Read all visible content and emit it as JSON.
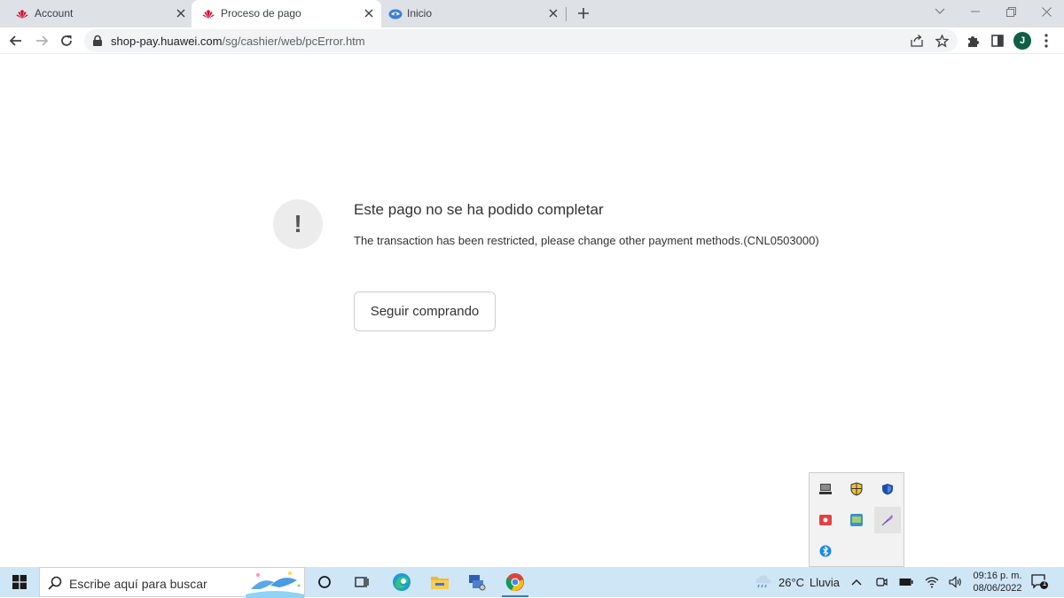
{
  "tabs": [
    {
      "title": "Account",
      "favicon": "huawei-icon",
      "active": false
    },
    {
      "title": "Proceso de pago",
      "favicon": "huawei-icon",
      "active": true
    },
    {
      "title": "Inicio",
      "favicon": "inicio-icon",
      "active": false
    }
  ],
  "toolbar": {
    "url_host": "shop-pay.huawei.com",
    "url_path": "/sg/cashier/web/pcError.htm",
    "avatar_initial": "J"
  },
  "page": {
    "error_title": "Este pago no se ha podido completar",
    "error_message": "The transaction has been restricted, please change other payment methods.(CNL0503000)",
    "error_icon_glyph": "!",
    "continue_button": "Seguir comprando"
  },
  "taskbar": {
    "search_placeholder": "Escribe aquí para buscar",
    "weather_temp": "26°C",
    "weather_desc": "Lluvia",
    "time": "09:16 p. m.",
    "date": "08/06/2022",
    "notification_count": "1"
  },
  "colors": {
    "huawei_red": "#cf0a2c",
    "tab_strip": "#dee1e6",
    "taskbar": "#cfe6f7",
    "avatar": "#0f5f46"
  }
}
